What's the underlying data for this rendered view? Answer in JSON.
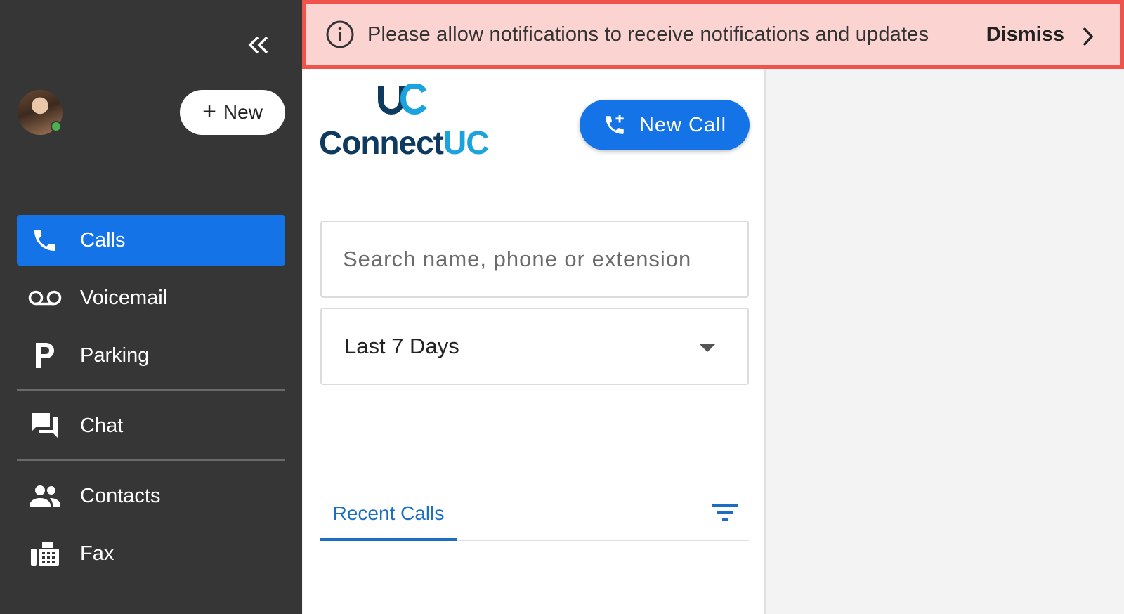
{
  "sidebar": {
    "new_label": "New",
    "items": [
      {
        "label": "Calls",
        "icon": "phone-icon",
        "active": true
      },
      {
        "label": "Voicemail",
        "icon": "voicemail-icon"
      },
      {
        "label": "Parking",
        "icon": "parking-icon"
      },
      {
        "label": "Chat",
        "icon": "chat-icon"
      },
      {
        "label": "Contacts",
        "icon": "contacts-icon"
      },
      {
        "label": "Fax",
        "icon": "fax-icon"
      }
    ],
    "status": "online"
  },
  "banner": {
    "message": "Please allow notifications to receive notifications and updates",
    "dismiss_label": "Dismiss"
  },
  "brand": {
    "name_part1": "Connect",
    "name_part2": "UC",
    "colors": {
      "dark": "#0f3a5f",
      "light": "#1aa3dd"
    }
  },
  "main": {
    "new_call_label": "New Call",
    "search_placeholder": "Search name, phone or extension",
    "date_filter": "Last 7 Days",
    "tabs": [
      {
        "label": "Recent Calls",
        "active": true
      }
    ]
  },
  "colors": {
    "accent": "#1473e6",
    "sidebar": "#363636",
    "banner_bg": "#fbd3d1",
    "banner_border": "#f0524c",
    "online": "#4caf50"
  }
}
